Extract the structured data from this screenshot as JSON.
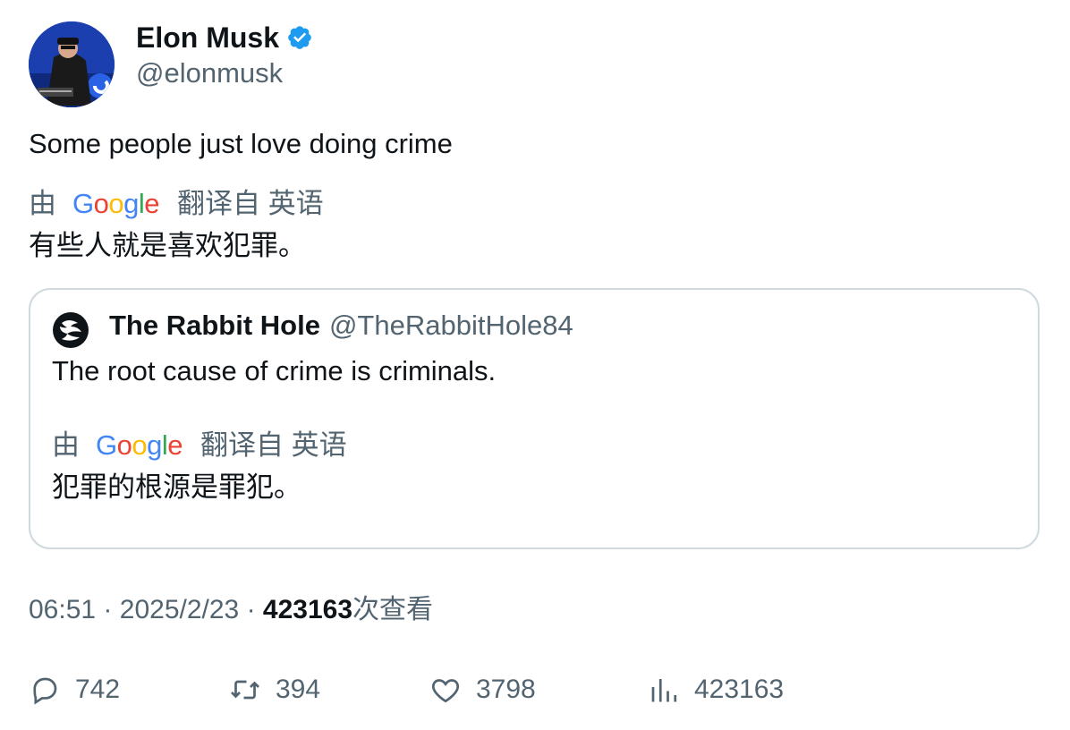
{
  "author": {
    "name": "Elon Musk",
    "handle": "@elonmusk",
    "verified_icon": "verified-badge-icon",
    "verified_color": "#1d9bf0"
  },
  "tweet": {
    "text": "Some people just love doing crime",
    "translation": {
      "prefix": "由",
      "provider": "Google",
      "suffix": "翻译自 英语",
      "text": "有些人就是喜欢犯罪。"
    }
  },
  "quote": {
    "name": "The Rabbit Hole",
    "handle": "@TheRabbitHole84",
    "text": "The root cause of crime is criminals.",
    "translation": {
      "prefix": "由",
      "provider": "Google",
      "suffix": "翻译自 英语",
      "text": "犯罪的根源是罪犯。"
    }
  },
  "meta": {
    "time": "06:51",
    "date": "2025/2/23",
    "views": "423163",
    "views_label": "次查看",
    "sep": "·"
  },
  "actions": {
    "replies": "742",
    "retweets": "394",
    "likes": "3798",
    "views": "423163"
  },
  "colors": {
    "text": "#0f1419",
    "secondary": "#536471",
    "border": "#cfd9de",
    "google_blue": "#4285f4",
    "google_red": "#ea4335",
    "google_yellow": "#fbbc05",
    "google_green": "#34a853"
  }
}
